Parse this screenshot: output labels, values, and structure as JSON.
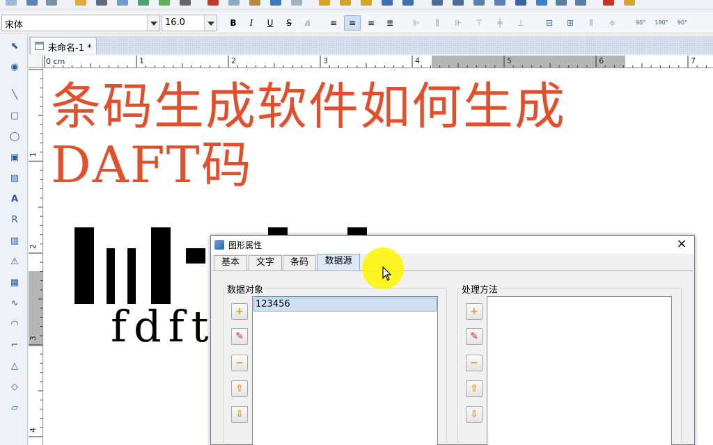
{
  "format_toolbar": {
    "font_name": "宋体",
    "font_size": "16.0",
    "bold": "B",
    "italic": "I",
    "underline": "U",
    "strike": "S",
    "rotate_90": "90°",
    "rotate_180": "180°",
    "rotate_270": "90°"
  },
  "document": {
    "tab_label": "未命名-1 *",
    "ruler_unit": "0 cm",
    "ruler_h_ticks": [
      "1",
      "2",
      "3",
      "4",
      "5",
      "6",
      "7"
    ],
    "ruler_v_ticks": [
      "1",
      "2",
      "3",
      "4"
    ],
    "title_line1": "条码生成软件如何生成",
    "title_line2": "DAFT码",
    "barcode_text": "fdft"
  },
  "dialog": {
    "title": "图形属性",
    "close": "×",
    "tabs": [
      "基本",
      "文字",
      "条码",
      "数据源"
    ],
    "active_tab": "数据源",
    "data_objects_label": "数据对象",
    "data_objects": [
      "123456"
    ],
    "processing_label": "处理方法"
  },
  "colors": {
    "title_text": "#e0502c",
    "selection": "#cfe0f3",
    "cursor_highlight": "#fff500"
  }
}
